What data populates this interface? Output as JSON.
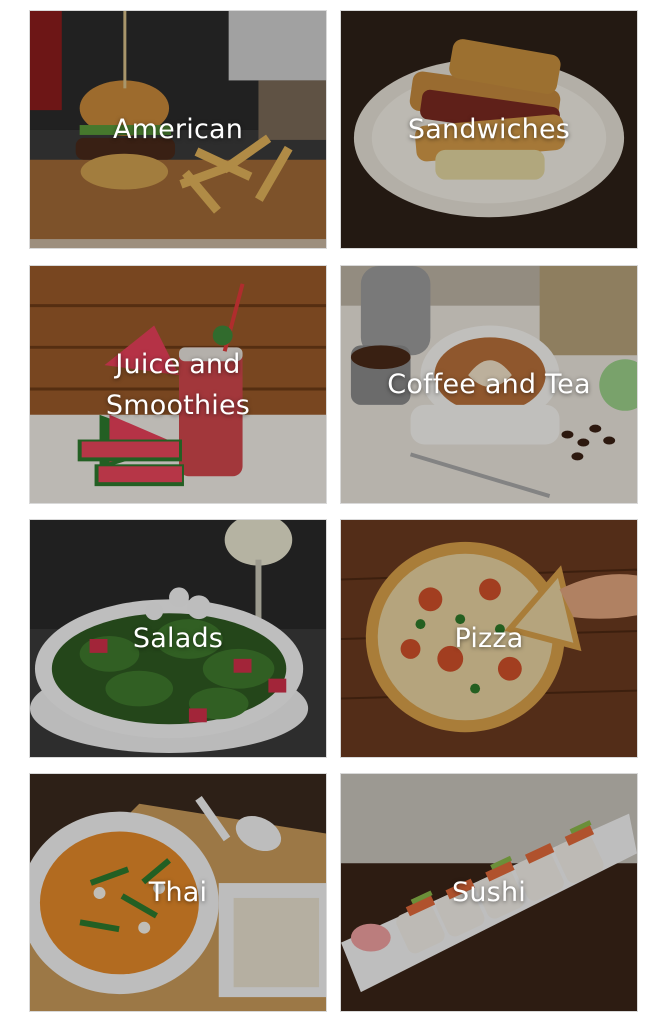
{
  "categories": [
    {
      "label": "American"
    },
    {
      "label": "Sandwiches"
    },
    {
      "label": "Juice and\nSmoothies"
    },
    {
      "label": "Coffee and Tea"
    },
    {
      "label": "Salads"
    },
    {
      "label": "Pizza"
    },
    {
      "label": "Thai"
    },
    {
      "label": "Sushi"
    }
  ]
}
